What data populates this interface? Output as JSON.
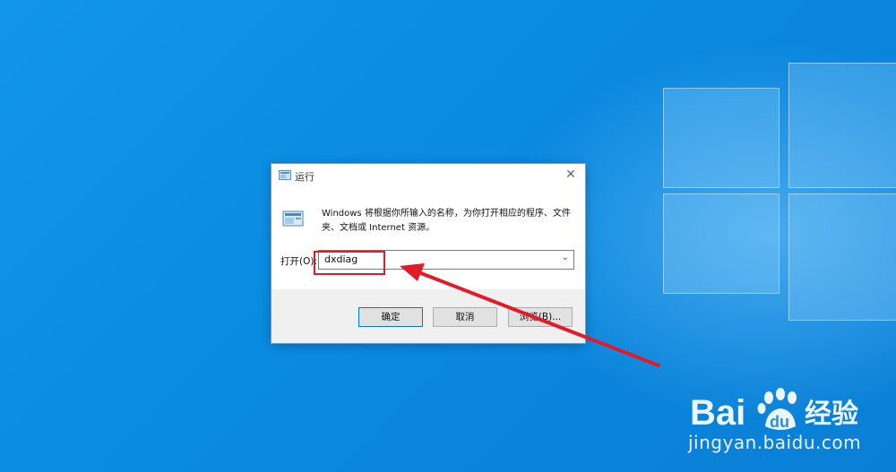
{
  "dialog": {
    "title": "运行",
    "description": "Windows 将根据你所输入的名称，为你打开相应的程序、文件夹、文档或 Internet 资源。",
    "open_label": "打开(O):",
    "input_value": "dxdiag",
    "buttons": {
      "ok": "确定",
      "cancel": "取消",
      "browse": "浏览(B)..."
    }
  },
  "annotation": {
    "color": "#e21b2b"
  },
  "watermark": {
    "brand": "Baidu经验",
    "url": "jingyan.baidu.com"
  }
}
